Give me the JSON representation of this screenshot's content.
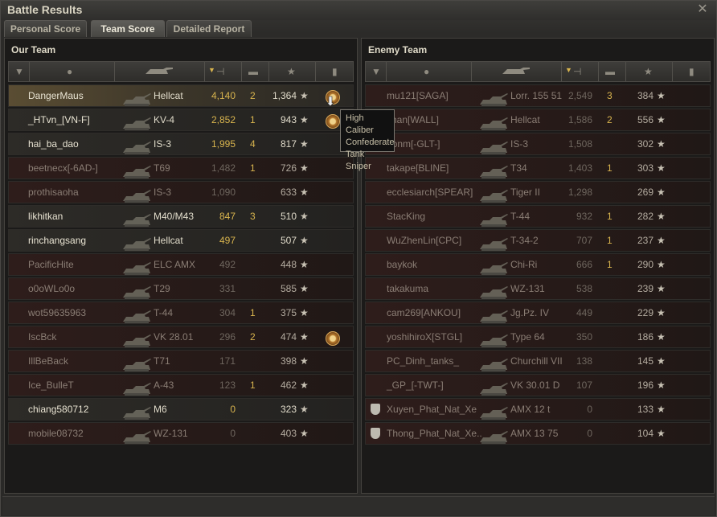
{
  "window": {
    "title": "Battle Results"
  },
  "tabs": [
    {
      "label": "Personal Score",
      "active": false
    },
    {
      "label": "Team Score",
      "active": true
    },
    {
      "label": "Detailed Report",
      "active": false
    }
  ],
  "our_team": {
    "title": "Our Team",
    "rows": [
      {
        "player": "DangerMaus",
        "tank": "Hellcat",
        "damage": "4,140",
        "kills": "2",
        "xp": "1,364",
        "status": "highlight",
        "medal": true
      },
      {
        "player": "_HTvn_[VN-F]",
        "tank": "KV-4",
        "damage": "2,852",
        "kills": "1",
        "xp": "943",
        "status": "alive",
        "medal": true
      },
      {
        "player": "hai_ba_dao",
        "tank": "IS-3",
        "damage": "1,995",
        "kills": "4",
        "xp": "817",
        "status": "alive",
        "medal": false
      },
      {
        "player": "beetnecx[-6AD-]",
        "tank": "T69",
        "damage": "1,482",
        "kills": "1",
        "xp": "726",
        "status": "dead",
        "medal": false
      },
      {
        "player": "prothisaoha",
        "tank": "IS-3",
        "damage": "1,090",
        "kills": "",
        "xp": "633",
        "status": "dead",
        "medal": false
      },
      {
        "player": "likhitkan",
        "tank": "M40/M43",
        "damage": "847",
        "kills": "3",
        "xp": "510",
        "status": "alive",
        "medal": false
      },
      {
        "player": "rinchangsang",
        "tank": "Hellcat",
        "damage": "497",
        "kills": "",
        "xp": "507",
        "status": "alive",
        "medal": false
      },
      {
        "player": "PacificHite",
        "tank": "ELC AMX",
        "damage": "492",
        "kills": "",
        "xp": "448",
        "status": "dead",
        "medal": false
      },
      {
        "player": "o0oWLo0o",
        "tank": "T29",
        "damage": "331",
        "kills": "",
        "xp": "585",
        "status": "dead",
        "medal": false
      },
      {
        "player": "wot59635963",
        "tank": "T-44",
        "damage": "304",
        "kills": "1",
        "xp": "375",
        "status": "dead",
        "medal": false
      },
      {
        "player": "IscBck",
        "tank": "VK 28.01",
        "damage": "296",
        "kills": "2",
        "xp": "474",
        "status": "dead",
        "medal": true
      },
      {
        "player": "IllBeBack",
        "tank": "T71",
        "damage": "171",
        "kills": "",
        "xp": "398",
        "status": "dead",
        "medal": false
      },
      {
        "player": "Ice_BulleT",
        "tank": "A-43",
        "damage": "123",
        "kills": "1",
        "xp": "462",
        "status": "dead",
        "medal": false
      },
      {
        "player": "chiang580712",
        "tank": "M6",
        "damage": "0",
        "kills": "",
        "xp": "323",
        "status": "alive",
        "medal": false
      },
      {
        "player": "mobile08732",
        "tank": "WZ-131",
        "damage": "0",
        "kills": "",
        "xp": "403",
        "status": "dead",
        "medal": false
      }
    ]
  },
  "enemy_team": {
    "title": "Enemy Team",
    "rows": [
      {
        "player": "mu121[SAGA]",
        "tank": "Lorr. 155 51",
        "damage": "2,549",
        "kills": "3",
        "xp": "384",
        "squad": false
      },
      {
        "player": "chan[WALL]",
        "tank": "Hellcat",
        "damage": "1,586",
        "kills": "2",
        "xp": "556",
        "squad": false
      },
      {
        "player": "epnm[-GLT-]",
        "tank": "IS-3",
        "damage": "1,508",
        "kills": "",
        "xp": "302",
        "squad": false
      },
      {
        "player": "takape[BLINE]",
        "tank": "T34",
        "damage": "1,403",
        "kills": "1",
        "xp": "303",
        "squad": false
      },
      {
        "player": "ecclesiarch[SPEAR]",
        "tank": "Tiger II",
        "damage": "1,298",
        "kills": "",
        "xp": "269",
        "squad": false
      },
      {
        "player": "StacKing",
        "tank": "T-44",
        "damage": "932",
        "kills": "1",
        "xp": "282",
        "squad": false
      },
      {
        "player": "WuZhenLin[CPC]",
        "tank": "T-34-2",
        "damage": "707",
        "kills": "1",
        "xp": "237",
        "squad": false
      },
      {
        "player": "baykok",
        "tank": "Chi-Ri",
        "damage": "666",
        "kills": "1",
        "xp": "290",
        "squad": false
      },
      {
        "player": "takakuma",
        "tank": "WZ-131",
        "damage": "538",
        "kills": "",
        "xp": "239",
        "squad": false
      },
      {
        "player": "cam269[ANKOU]",
        "tank": "Jg.Pz. IV",
        "damage": "449",
        "kills": "",
        "xp": "229",
        "squad": false
      },
      {
        "player": "yoshihiroX[STGL]",
        "tank": "Type 64",
        "damage": "350",
        "kills": "",
        "xp": "186",
        "squad": false
      },
      {
        "player": "PC_Dinh_tanks_",
        "tank": "Churchill VII",
        "damage": "138",
        "kills": "",
        "xp": "145",
        "squad": false
      },
      {
        "player": "_GP_[-TWT-]",
        "tank": "VK 30.01 D",
        "damage": "107",
        "kills": "",
        "xp": "196",
        "squad": false
      },
      {
        "player": "Xuyen_Phat_Nat_Xe",
        "tank": "AMX 12 t",
        "damage": "0",
        "kills": "",
        "xp": "133",
        "squad": true
      },
      {
        "player": "Thong_Phat_Nat_Xe..",
        "tank": "AMX 13 75",
        "damage": "0",
        "kills": "",
        "xp": "104",
        "squad": true
      }
    ]
  },
  "tooltip": {
    "lines": [
      "High Caliber",
      "Confederate",
      "Tank Sniper"
    ]
  },
  "star_glyph": "★"
}
